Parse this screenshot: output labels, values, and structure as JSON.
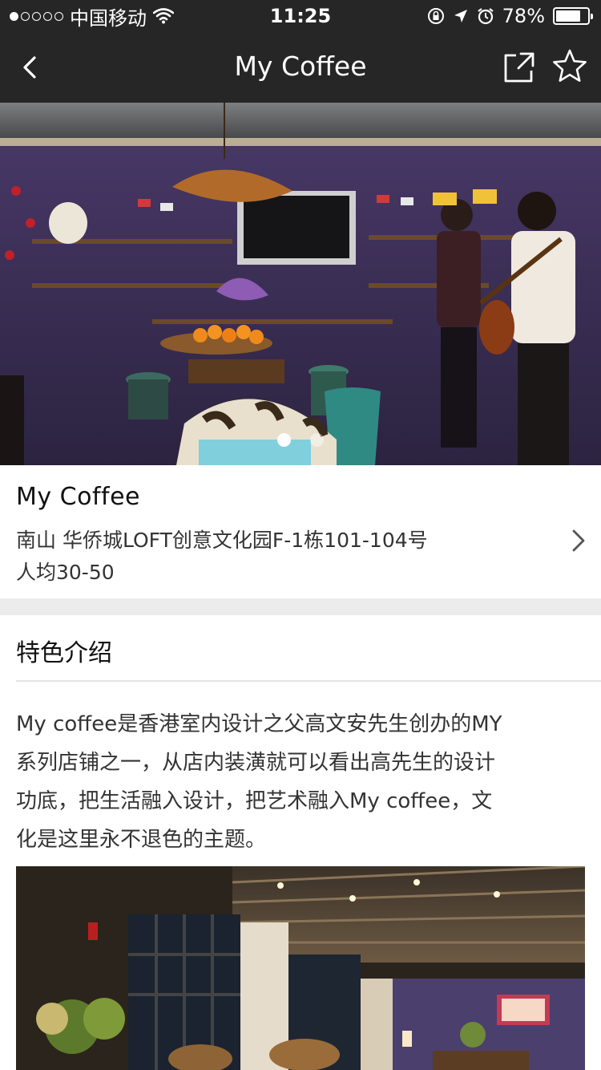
{
  "status_bar": {
    "carrier": "中国移动",
    "time": "11:25",
    "battery": "78%",
    "battery_level": 0.78
  },
  "nav": {
    "title": "My Coffee",
    "back_icon": "chevron-left-icon",
    "share_icon": "share-icon",
    "favorite_icon": "star-icon"
  },
  "hero": {
    "page_count": 2,
    "active_page": 1
  },
  "shop": {
    "name": "My Coffee",
    "address": "南山 华侨城LOFT创意文化园F-1栋101-104号",
    "price": "人均30-50"
  },
  "feature": {
    "title": "特色介绍",
    "lines": [
      "My coffee是香港室内设计之父高文安先生创办的MY",
      "系列店铺之一，从店内装潢就可以看出高先生的设计",
      "功底，把生活融入设计，把艺术融入My coffee，文",
      "化是这里永不退色的主题。"
    ]
  },
  "colors": {
    "bar_background": "#262626",
    "section_gap": "#ececec",
    "text_primary": "#111111",
    "text_secondary": "#333333"
  }
}
